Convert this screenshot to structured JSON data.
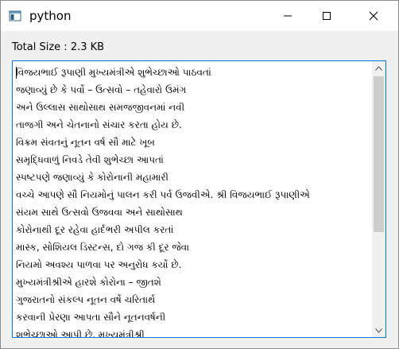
{
  "window": {
    "title": "python"
  },
  "colors": {
    "focus_border": "#0078d7",
    "scroll_thumb": "#cdcdcd"
  },
  "info": {
    "total_size": "Total Size : 2.3 KB"
  },
  "text_area": {
    "lines": [
      "વિજયભાઈ રૂપાણી મુખ્યમંત્રીએ શુભેચ્છાઓ પાઠવતાં",
      "જણાવ્યું છે કે પર્વો – ઉત્સવો – તહેવારો ઉમંગ",
      "અને ઉલ્લાસ સાથોસાથ સમજજીવનમાં નવી",
      "તાજગી અને ચેતનાનો સંચાર કરતા હોય છે.",
      "વિક્રમ સંવતનું નૂતન વર્ષ સૌ માટે ખૂબ",
      "સમૃદ્ધિવાળું નિવડે તેવી શુભેચ્છા આપતાં",
      "સ્પષ્ટપણે જણાવ્યું કે કોરોનાની મહામારી",
      "વચ્ચે આપણે સૌ નિયમોનું પાલન કરી પર્વ ઉજવીએ. શ્રી વિજયભાઈ રૂપાણીએ",
      "સંયમ સાથે ઉત્સવો ઉજવવા અને સાથોસાથ",
      "કોરોનાથી દૂર રહેવા હાર્દભરી અપીલ કરતાં",
      "માસ્ક, સોશિયલ ડિસ્ટન્સ, દો ગજ કી દૂર જેવા",
      "નિયમો અવશ્ય પાળવા પર અનુરોધ કર્યો છે.",
      "મુખ્યમંત્રીશ્રીએ હારશે કોરોના – જીતશે",
      "ગુજરાતનો સંકલ્પ નૂતન વર્ષે ચરિતાર્થ",
      "કરવાની પ્રેરણા આપતા સૌને નૂતનવર્ષની",
      "શુભેચ્છાઓ આપી છે. મુખ્યમંત્રીશ્રી"
    ]
  },
  "icons": {
    "app": "window-app-icon",
    "minimize": "minimize-icon",
    "maximize": "maximize-icon",
    "close": "close-icon",
    "scroll_up": "scroll-up-arrow-icon",
    "scroll_down": "scroll-down-arrow-icon"
  }
}
